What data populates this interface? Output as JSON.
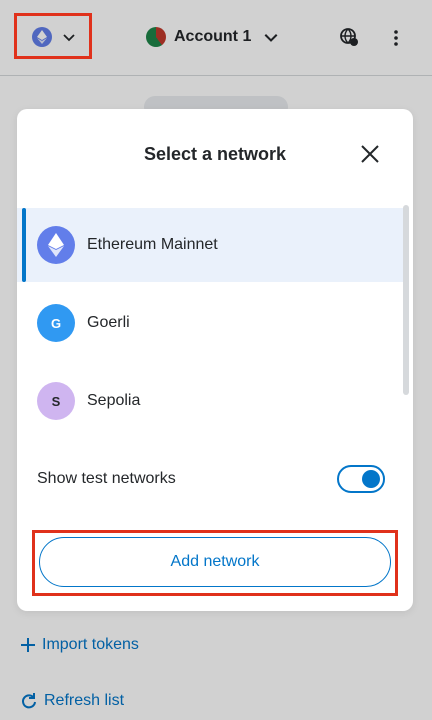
{
  "header": {
    "account_name": "Account 1"
  },
  "modal": {
    "title": "Select a network",
    "networks": [
      {
        "label": "Ethereum Mainnet",
        "icon": "ethereum-icon",
        "selected": true
      },
      {
        "label": "Goerli",
        "initial": "G",
        "color": "#3099f2"
      },
      {
        "label": "Sepolia",
        "initial": "S",
        "color": "#cfb5f0"
      }
    ],
    "show_test_networks_label": "Show test networks",
    "show_test_networks_enabled": true,
    "add_network_label": "Add network"
  },
  "footer": {
    "import_tokens_label": "Import tokens",
    "refresh_list_label": "Refresh list"
  },
  "colors": {
    "accent": "#0376c9",
    "highlight": "#e0311b",
    "selected_row": "#eaf1fb"
  }
}
